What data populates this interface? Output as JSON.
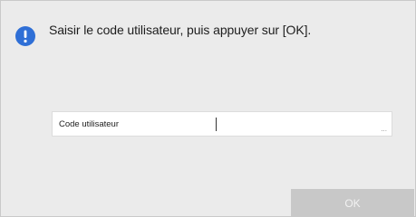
{
  "dialog": {
    "icon": "exclamation-icon",
    "message": "Saisir le code utilisateur, puis appuyer sur [OK]."
  },
  "user_code": {
    "label": "Code utilisateur",
    "value": "",
    "more_indicator": "..."
  },
  "ok_button": {
    "label": "OK",
    "enabled": false
  },
  "colors": {
    "accent": "#2f6fd6",
    "background": "#ebebeb",
    "button_disabled": "#c8c8c8"
  }
}
